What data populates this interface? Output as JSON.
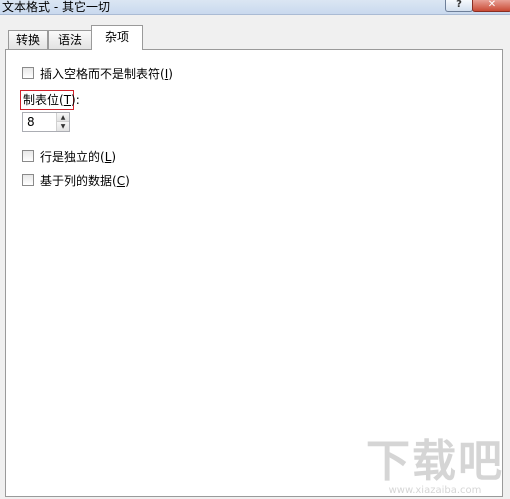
{
  "window": {
    "title": "文本格式 - 其它一切",
    "help_glyph": "?",
    "close_glyph": "✕"
  },
  "tabs": [
    {
      "label": "转换",
      "active": false
    },
    {
      "label": "语法",
      "active": false
    },
    {
      "label": "杂项",
      "active": true
    }
  ],
  "misc": {
    "insert_spaces": {
      "label": "插入空格而不是制表符(",
      "mnemonic": "I",
      "close": ")",
      "checked": false
    },
    "tab_stop": {
      "label": "制表位(",
      "mnemonic": "T",
      "close": "):",
      "value": "8"
    },
    "line_independent": {
      "label": "行是独立的(",
      "mnemonic": "L",
      "close": ")",
      "checked": false
    },
    "column_based": {
      "label": "基于列的数据(",
      "mnemonic": "C",
      "close": ")",
      "checked": false
    }
  },
  "watermark": {
    "main": "下载吧",
    "sub": "www.xiazaiba.com"
  }
}
